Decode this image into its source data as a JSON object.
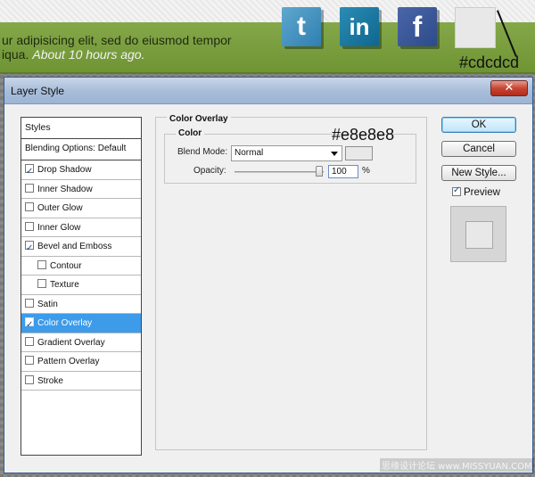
{
  "webpage": {
    "body_line1": "ur adipisicing elit, sed do eiusmod tempor",
    "body_line2": "iqua.",
    "timestamp": "About 10 hours ago.",
    "social_icons": [
      {
        "name": "twitter-icon",
        "glyph": "t"
      },
      {
        "name": "linkedin-icon",
        "glyph": "in"
      },
      {
        "name": "facebook-icon",
        "glyph": "f"
      }
    ],
    "swatch_annotation": "#cdcdcd"
  },
  "dialog": {
    "title": "Layer Style",
    "close_glyph": "✕",
    "styles_header": "Styles",
    "blending_options": "Blending Options: Default",
    "effects": [
      {
        "label": "Drop Shadow",
        "checked": true
      },
      {
        "label": "Inner Shadow",
        "checked": false
      },
      {
        "label": "Outer Glow",
        "checked": false
      },
      {
        "label": "Inner Glow",
        "checked": false
      },
      {
        "label": "Bevel and Emboss",
        "checked": true
      },
      {
        "label": "Contour",
        "checked": false
      },
      {
        "label": "Texture",
        "checked": false
      },
      {
        "label": "Satin",
        "checked": false
      },
      {
        "label": "Color Overlay",
        "checked": true
      },
      {
        "label": "Gradient Overlay",
        "checked": false
      },
      {
        "label": "Pattern Overlay",
        "checked": false
      },
      {
        "label": "Stroke",
        "checked": false
      }
    ],
    "panel": {
      "title": "Color Overlay",
      "group_title": "Color",
      "blend_mode_label": "Blend Mode:",
      "blend_mode_value": "Normal",
      "opacity_label": "Opacity:",
      "opacity_value": "100",
      "opacity_unit": "%",
      "overlay_color": "#e8e8e8",
      "color_annotation": "#e8e8e8"
    },
    "buttons": {
      "ok": "OK",
      "cancel": "Cancel",
      "new_style": "New Style...",
      "preview_label": "Preview"
    }
  },
  "watermark": "思缘设计论坛 www.MISSYUAN.COM"
}
